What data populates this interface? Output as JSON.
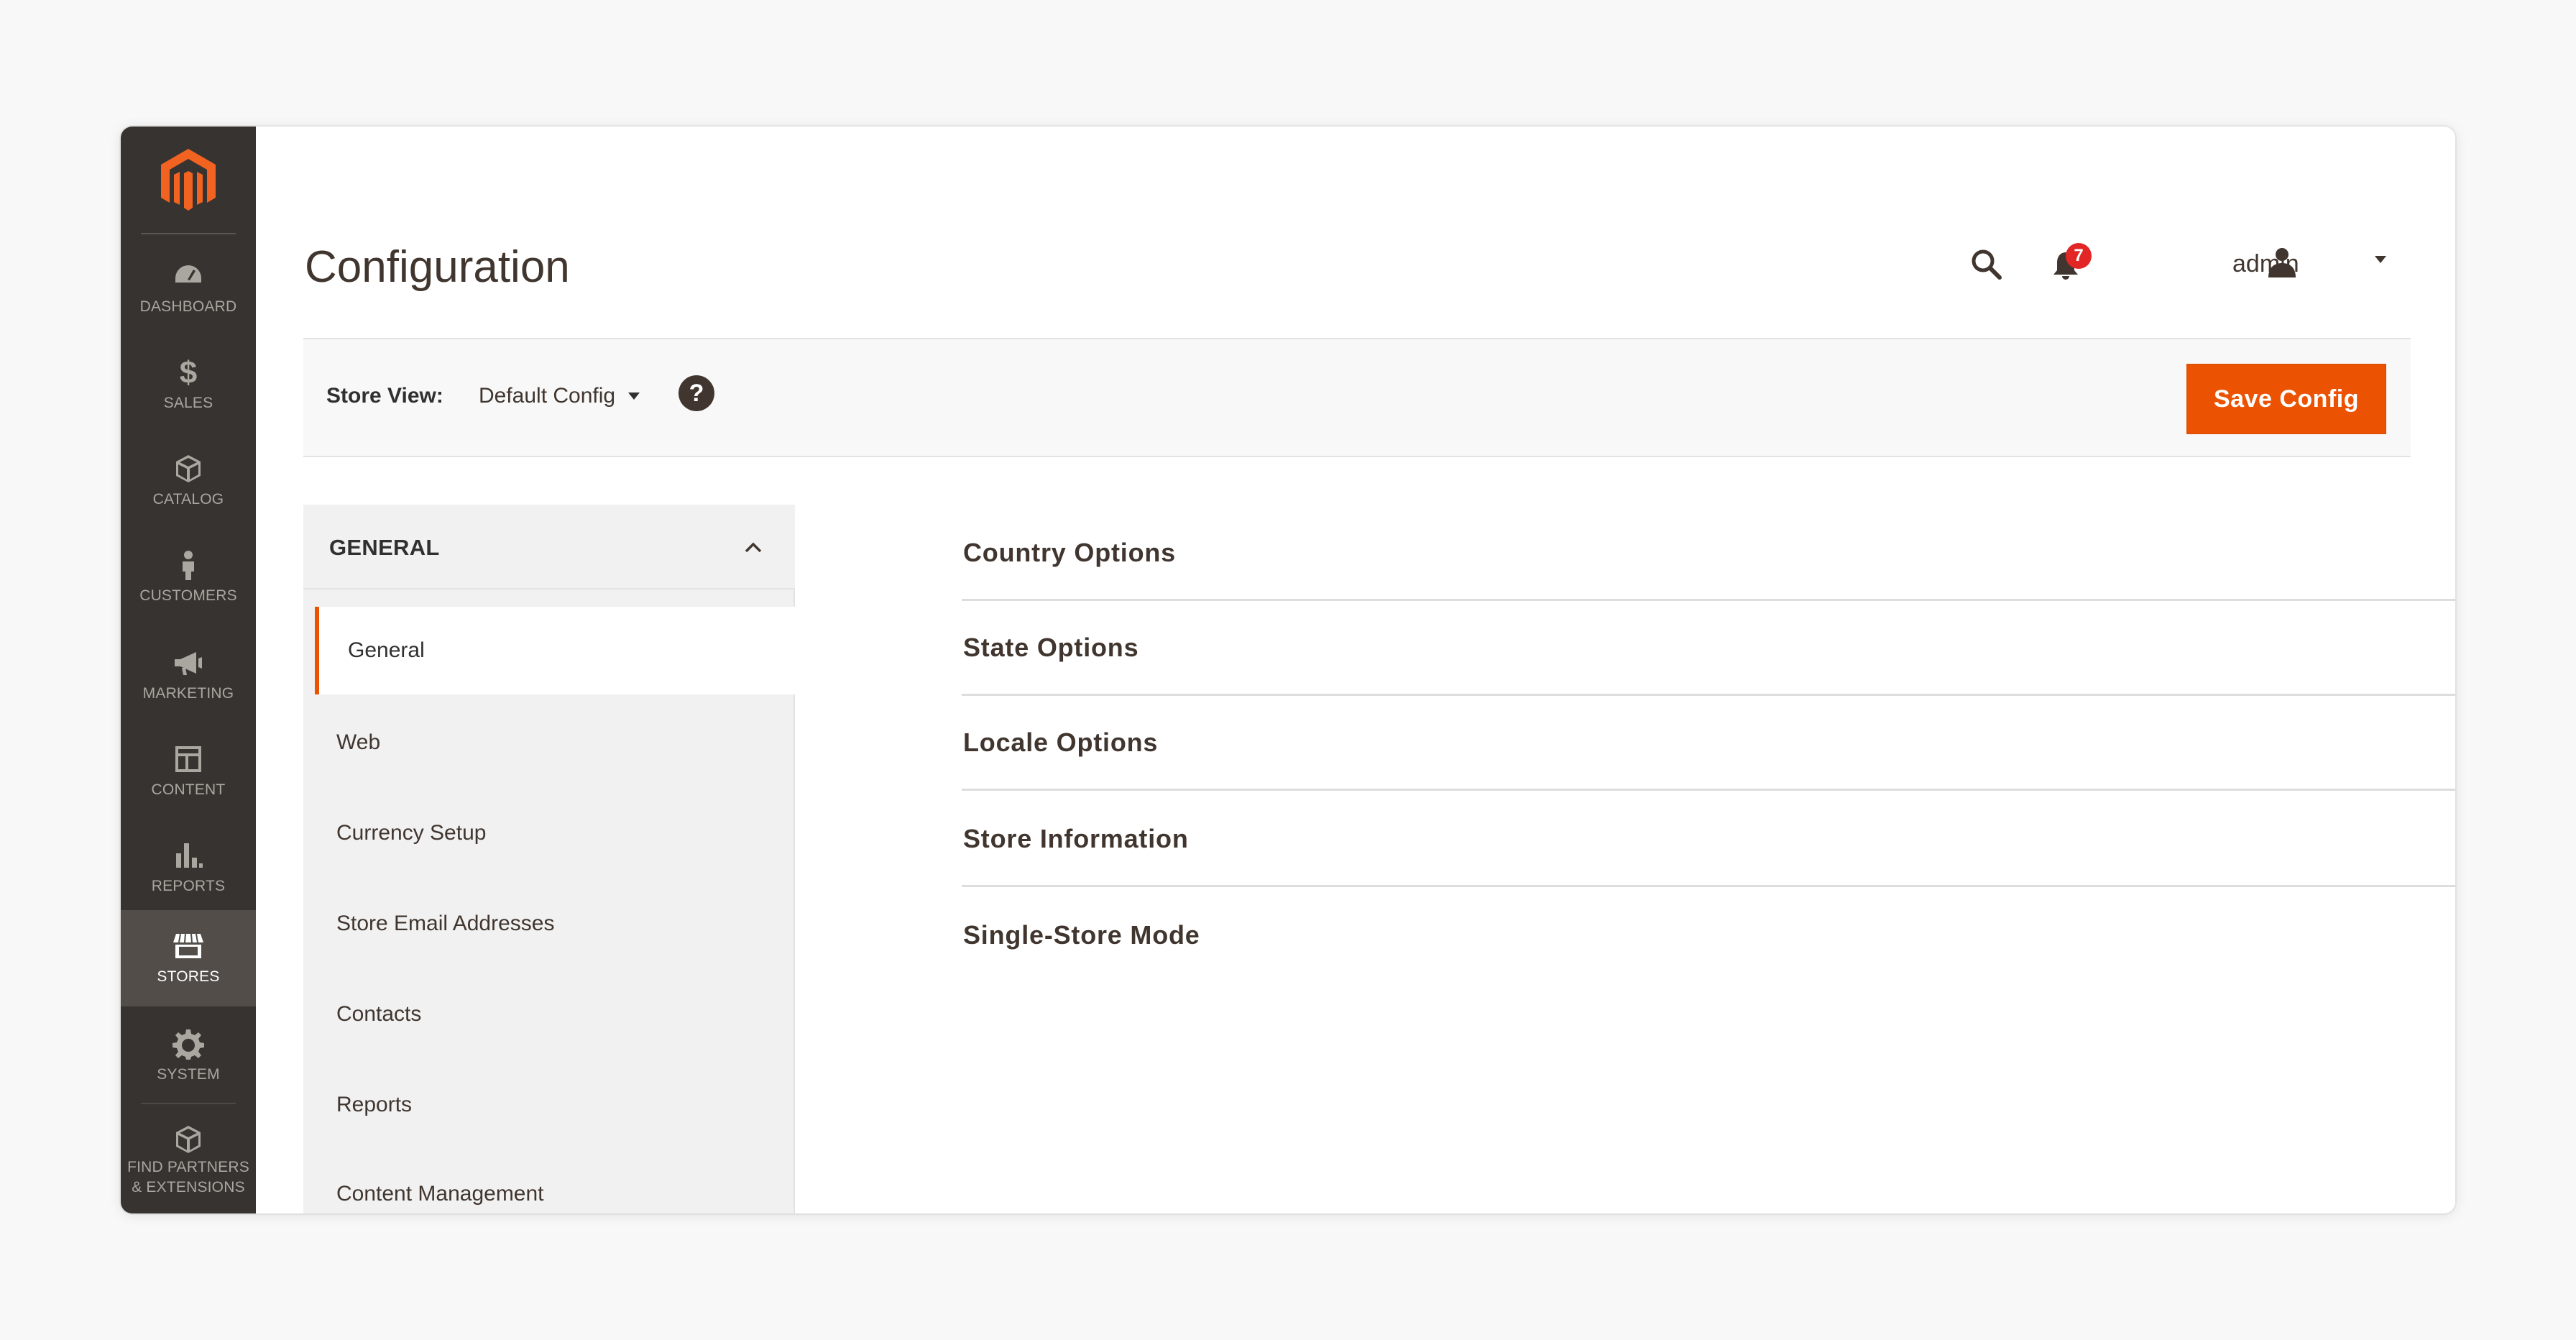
{
  "sidebar": {
    "items": [
      {
        "label": "DASHBOARD",
        "icon": "dashboard-icon"
      },
      {
        "label": "SALES",
        "icon": "dollar-icon"
      },
      {
        "label": "CATALOG",
        "icon": "catalog-box-icon"
      },
      {
        "label": "CUSTOMERS",
        "icon": "customer-person-icon"
      },
      {
        "label": "MARKETING",
        "icon": "megaphone-icon"
      },
      {
        "label": "CONTENT",
        "icon": "content-layout-icon"
      },
      {
        "label": "REPORTS",
        "icon": "bar-chart-icon"
      },
      {
        "label": "STORES",
        "icon": "storefront-icon",
        "active": true
      },
      {
        "label": "SYSTEM",
        "icon": "gear-icon"
      },
      {
        "label_line1": "FIND PARTNERS",
        "label_line2": "& EXTENSIONS",
        "icon": "partners-box-icon"
      }
    ]
  },
  "header": {
    "title": "Configuration",
    "notification_count": "7",
    "user": "admin"
  },
  "store_view": {
    "label": "Store View:",
    "selected": "Default Config"
  },
  "toolbar": {
    "save_label": "Save Config"
  },
  "tabs": {
    "group_title": "GENERAL",
    "items": [
      "General",
      "Web",
      "Currency Setup",
      "Store Email Addresses",
      "Contacts",
      "Reports",
      "Content Management"
    ],
    "active": "General"
  },
  "sections": [
    "Country Options",
    "State Options",
    "Locale Options",
    "Store Information",
    "Single-Store Mode"
  ],
  "colors": {
    "accent": "#eb5202",
    "sidebar_bg": "#373330",
    "sidebar_active": "#524d49",
    "badge": "#e22626"
  }
}
